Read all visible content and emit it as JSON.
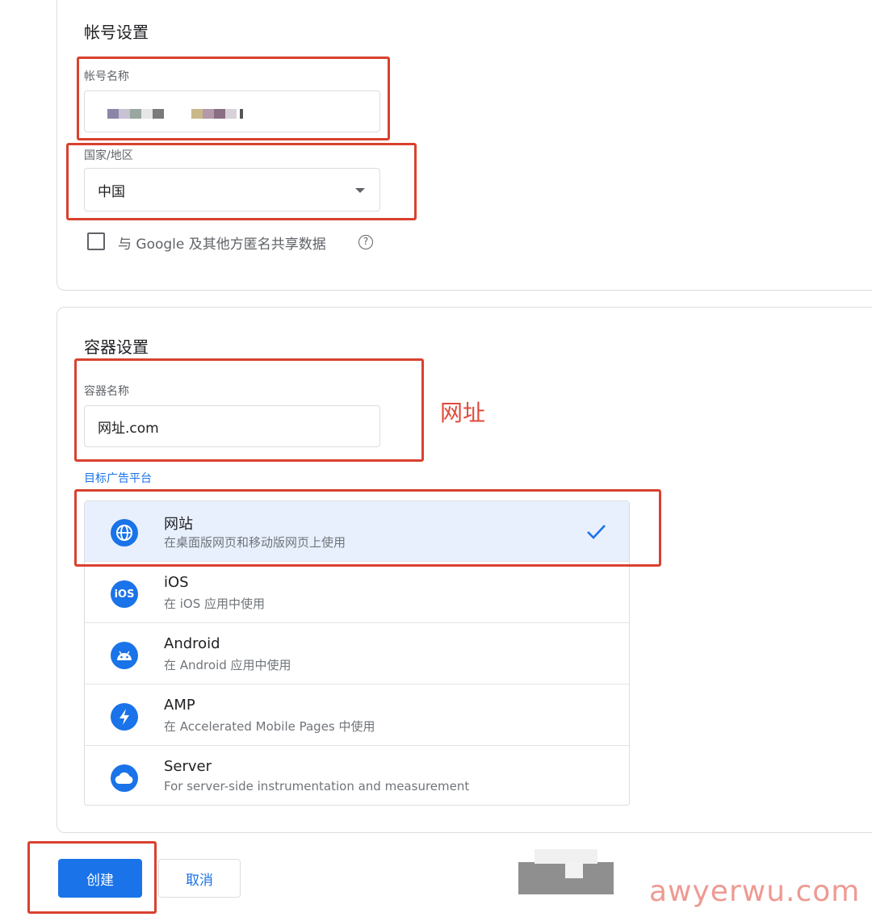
{
  "account_section": {
    "title": "帐号设置",
    "account_name_label": "帐号名称",
    "country_label": "国家/地区",
    "country_value": "中国",
    "share_checkbox_label": "与 Google 及其他方匿名共享数据",
    "help_glyph": "?"
  },
  "container_section": {
    "title": "容器设置",
    "container_name_label": "容器名称",
    "container_name_value": "网址.com",
    "target_platform_label": "目标广告平台",
    "platforms": [
      {
        "title": "网站",
        "desc": "在桌面版网页和移动版网页上使用",
        "icon": "globe-icon",
        "selected": true
      },
      {
        "title": "iOS",
        "desc": "在 iOS 应用中使用",
        "icon": "ios-icon",
        "icon_text": "iOS",
        "selected": false
      },
      {
        "title": "Android",
        "desc": "在 Android 应用中使用",
        "icon": "android-icon",
        "selected": false
      },
      {
        "title": "AMP",
        "desc": "在 Accelerated Mobile Pages 中使用",
        "icon": "amp-bolt-icon",
        "selected": false
      },
      {
        "title": "Server",
        "desc": "For server-side instrumentation and measurement",
        "icon": "cloud-icon",
        "selected": false
      }
    ]
  },
  "annotation": {
    "url_note": "网址"
  },
  "actions": {
    "create_label": "创建",
    "cancel_label": "取消"
  },
  "watermark": "awyerwu.com",
  "colors": {
    "accent": "#1a73e8",
    "annotation_red": "#d9412f",
    "selected_bg": "#e8f0fe"
  }
}
